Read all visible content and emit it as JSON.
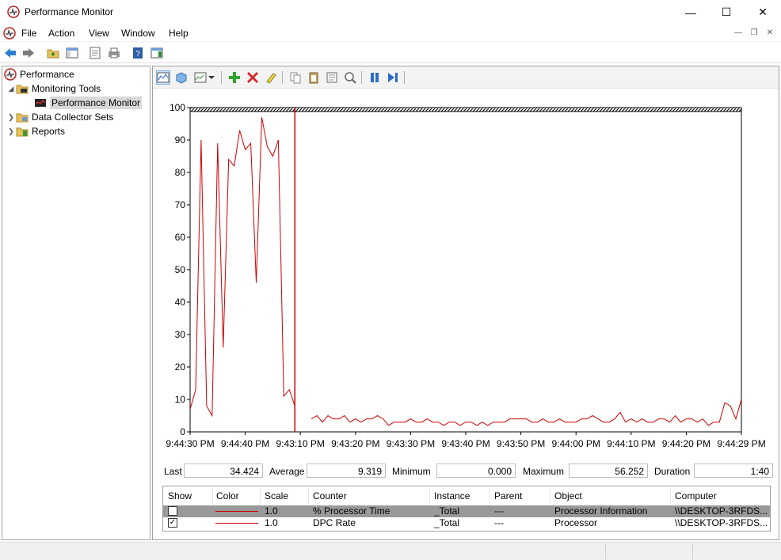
{
  "window": {
    "title": "Performance Monitor"
  },
  "menu": [
    "File",
    "Action",
    "View",
    "Window",
    "Help"
  ],
  "tree": {
    "root": "Performance",
    "monitoring_tools": "Monitoring Tools",
    "performance_monitor": "Performance Monitor",
    "data_collector_sets": "Data Collector Sets",
    "reports": "Reports"
  },
  "stats": {
    "last_label": "Last",
    "last_value": "34.424",
    "average_label": "Average",
    "average_value": "9.319",
    "minimum_label": "Minimum",
    "minimum_value": "0.000",
    "maximum_label": "Maximum",
    "maximum_value": "56.252",
    "duration_label": "Duration",
    "duration_value": "1:40"
  },
  "legend": {
    "headers": [
      "Show",
      "Color",
      "Scale",
      "Counter",
      "Instance",
      "Parent",
      "Object",
      "Computer"
    ],
    "rows": [
      {
        "checked": false,
        "scale": "1.0",
        "counter": "% Processor Time",
        "instance": "_Total",
        "parent": "---",
        "object": "Processor Information",
        "computer": "\\\\DESKTOP-3RFDS..."
      },
      {
        "checked": true,
        "scale": "1.0",
        "counter": "DPC Rate",
        "instance": "_Total",
        "parent": "---",
        "object": "Processor",
        "computer": "\\\\DESKTOP-3RFDS..."
      }
    ]
  },
  "colors": {
    "series": "#cc0000",
    "selected_row": "#999999"
  },
  "chart_data": {
    "type": "line",
    "title": "",
    "ylim": [
      0,
      100
    ],
    "yticks": [
      "0",
      "10",
      "20",
      "30",
      "40",
      "50",
      "60",
      "70",
      "80",
      "90",
      "100"
    ],
    "xtick_labels": [
      "9:44:30 PM",
      "9:44:40 PM",
      "9:43:10 PM",
      "9:43:20 PM",
      "9:43:30 PM",
      "9:43:40 PM",
      "9:43:50 PM",
      "9:44:00 PM",
      "9:44:10 PM",
      "9:44:20 PM",
      "9:44:29 PM"
    ],
    "sample_count": 100,
    "current_index": 19,
    "series": [
      {
        "values": [
          7,
          13,
          90,
          8,
          5,
          89,
          26,
          84,
          82,
          93,
          87,
          89,
          46,
          97,
          88,
          85,
          90,
          11,
          13,
          8,
          null,
          null,
          4,
          5,
          3,
          5,
          4,
          4,
          5,
          3,
          4,
          3,
          4,
          4,
          5,
          4,
          2,
          3,
          3,
          3,
          4,
          3,
          3,
          4,
          3,
          3,
          2,
          3,
          3,
          2,
          3,
          3,
          2,
          3,
          2,
          3,
          3,
          3,
          4,
          4,
          4,
          4,
          3,
          3,
          4,
          3,
          3,
          4,
          3,
          3,
          3,
          4,
          4,
          5,
          4,
          3,
          3,
          4,
          6,
          3,
          4,
          3,
          4,
          3,
          3,
          4,
          4,
          3,
          5,
          3,
          4,
          4,
          3,
          4,
          2,
          3,
          3,
          9,
          8,
          4,
          10
        ]
      }
    ]
  }
}
